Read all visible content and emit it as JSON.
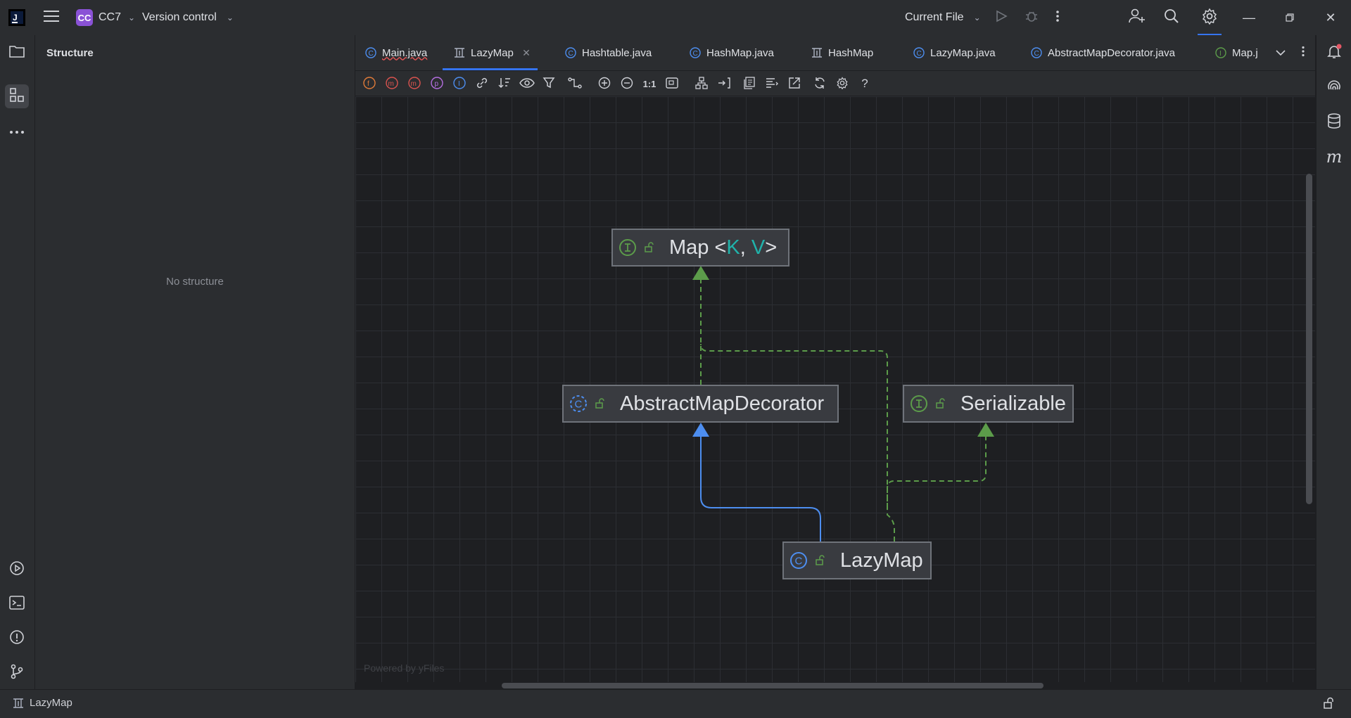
{
  "titlebar": {
    "project_badge": "CC",
    "project_name": "CC7",
    "vcs_label": "Version control",
    "run_config": "Current File"
  },
  "structure_panel": {
    "title": "Structure",
    "empty_text": "No structure"
  },
  "tabs": [
    {
      "label": "Main.java",
      "icon": "class-icon"
    },
    {
      "label": "LazyMap",
      "icon": "diagram-icon",
      "active": true
    },
    {
      "label": "Hashtable.java",
      "icon": "class-icon"
    },
    {
      "label": "HashMap.java",
      "icon": "class-icon"
    },
    {
      "label": "HashMap",
      "icon": "diagram-icon"
    },
    {
      "label": "LazyMap.java",
      "icon": "class-icon"
    },
    {
      "label": "AbstractMapDecorator.java",
      "icon": "class-icon"
    },
    {
      "label": "Map.j",
      "icon": "interface-icon"
    }
  ],
  "toolbar": {
    "actual_size_label": "1:1",
    "help_label": "?"
  },
  "diagram": {
    "nodes": {
      "map": {
        "name": "Map",
        "lt": "<",
        "k": "K",
        "sep": ",",
        "v": "V",
        "gt": ">",
        "kind": "interface"
      },
      "abstract": {
        "name": "AbstractMapDecorator",
        "kind": "abstract-class"
      },
      "serializable": {
        "name": "Serializable",
        "kind": "interface"
      },
      "lazymap": {
        "name": "LazyMap",
        "kind": "class"
      }
    },
    "watermark": "Powered by yFiles"
  },
  "statusbar": {
    "breadcrumb": "LazyMap"
  },
  "colors": {
    "accent": "#3574f0",
    "realization_edge": "#5c9c4a",
    "extends_edge": "#4d8ef0",
    "type_param": "#20b2aa"
  }
}
